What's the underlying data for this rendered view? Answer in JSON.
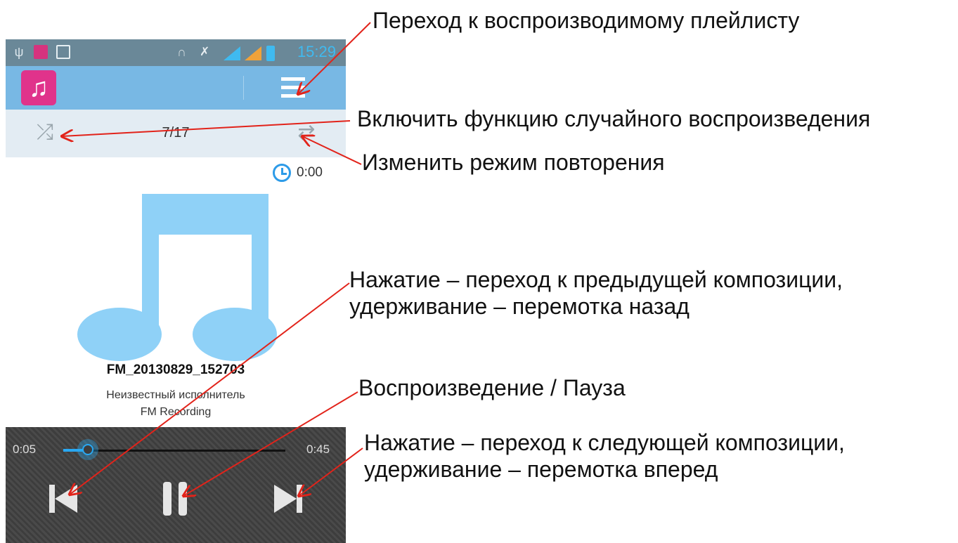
{
  "status_bar": {
    "time": "15:29",
    "usb": "ψ",
    "headphones": "∩",
    "mute": "✗"
  },
  "app": {
    "icon_glyph": "♫",
    "accent_color": "#78b8e4",
    "brand_color": "#e0338b"
  },
  "controls": {
    "shuffle_glyph": "⤮",
    "repeat_glyph": "⇄",
    "track_position": "7/17"
  },
  "timer": {
    "value": "0:00"
  },
  "track": {
    "title": "FM_20130829_152703",
    "artist": "Неизвестный исполнитель",
    "album": "FM Recording"
  },
  "player": {
    "elapsed": "0:05",
    "duration": "0:45",
    "progress": 0.11
  },
  "callouts": {
    "playlist": "Переход к воспроизводимому плейлисту",
    "shuffle": "Включить функцию случайного воспроизведения",
    "repeat": "Изменить режим повторения",
    "prev_line1": "Нажатие – переход к предыдущей композиции,",
    "prev_line2": "удерживание – перемотка назад",
    "play_pause": "Воспроизведение / Пауза",
    "next_line1": "Нажатие – переход к следующей композиции,",
    "next_line2": "удерживание – перемотка вперед"
  },
  "arrow_color": "#e2231a"
}
